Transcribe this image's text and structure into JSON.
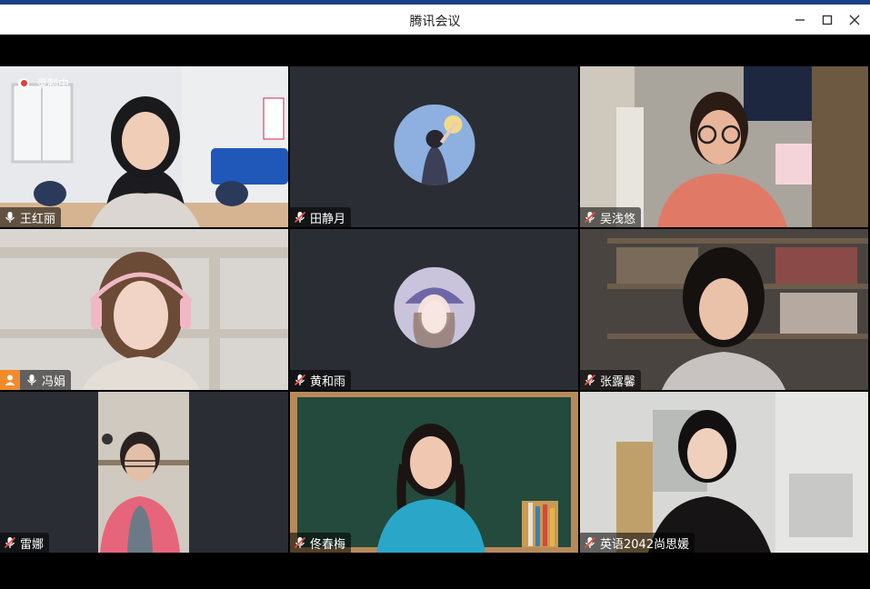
{
  "window": {
    "title": "腾讯会议"
  },
  "recording": {
    "label": "录制中"
  },
  "participants": [
    {
      "name": "王红丽",
      "mic": "on",
      "video": true
    },
    {
      "name": "田静月",
      "mic": "muted",
      "video": false
    },
    {
      "name": "吴浅悠",
      "mic": "muted",
      "video": true
    },
    {
      "name": "冯娟",
      "mic": "on",
      "video": true,
      "host": true
    },
    {
      "name": "黄和雨",
      "mic": "muted",
      "video": false
    },
    {
      "name": "张露馨",
      "mic": "muted",
      "video": true
    },
    {
      "name": "雷娜",
      "mic": "muted",
      "video": true
    },
    {
      "name": "佟春梅",
      "mic": "muted",
      "video": true
    },
    {
      "name": "英语2042尚思媛",
      "mic": "muted",
      "video": true
    }
  ],
  "colors": {
    "title_bar_accent": "#1b3f86",
    "tile_background": "#2a2d33",
    "active_speaker_border": "#2bd06f",
    "recording_dot": "#e0403a",
    "host_badge": "#f28a2a"
  }
}
